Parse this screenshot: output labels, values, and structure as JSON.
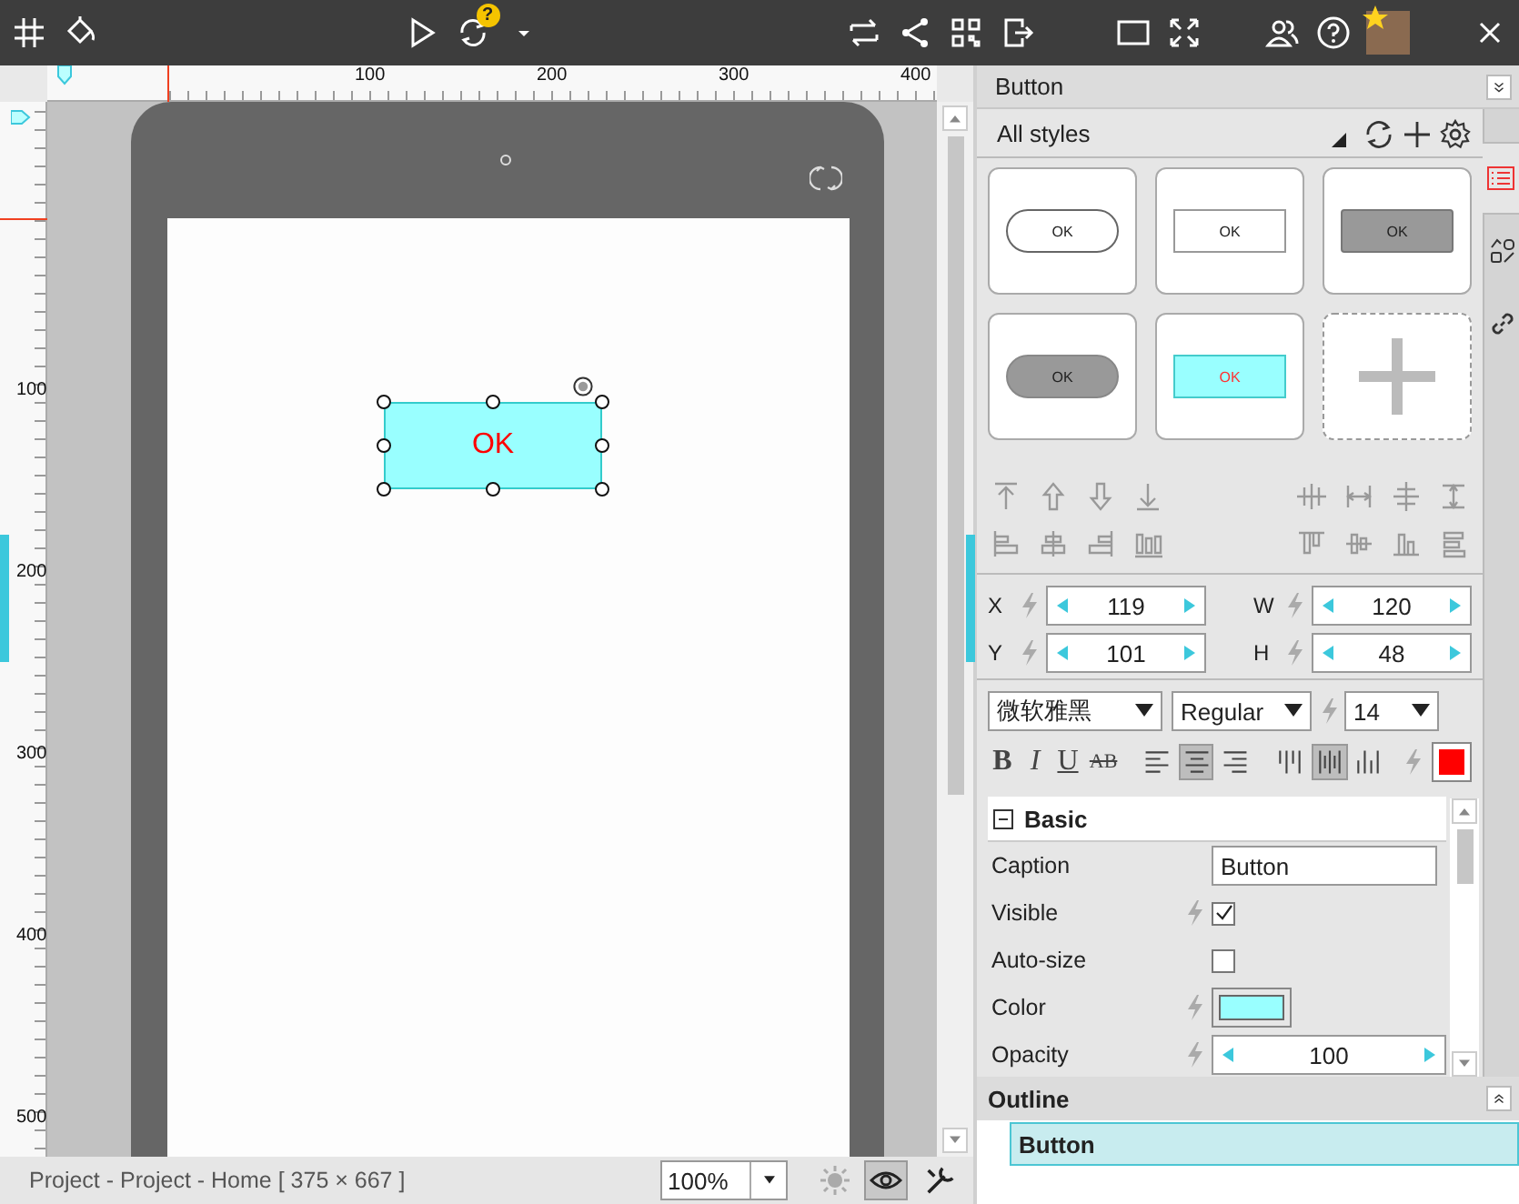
{
  "toolbar": {
    "help_badge": "?"
  },
  "rulers": {
    "horizontal": [
      "100",
      "200",
      "300",
      "400"
    ],
    "vertical": [
      "100",
      "200",
      "300",
      "400",
      "500"
    ]
  },
  "canvas": {
    "widget": {
      "caption": "OK",
      "selected": true
    }
  },
  "panel": {
    "title": "Button",
    "style_filter": "All styles",
    "styles": [
      {
        "kind": "pill",
        "label": "OK"
      },
      {
        "kind": "plain",
        "label": "OK"
      },
      {
        "kind": "dark",
        "label": "OK"
      },
      {
        "kind": "dark-pill",
        "label": "OK"
      },
      {
        "kind": "cyan",
        "label": "OK"
      },
      {
        "kind": "add"
      }
    ],
    "geometry": [
      {
        "label": "X",
        "value": "119",
        "linked": true
      },
      {
        "label": "W",
        "value": "120",
        "linked": true
      },
      {
        "label": "Y",
        "value": "101",
        "linked": true
      },
      {
        "label": "H",
        "value": "48",
        "linked": true
      }
    ],
    "font": {
      "family": "微软雅黑",
      "weight": "Regular",
      "size": "14"
    },
    "format_buttons": [
      {
        "kind": "bold",
        "label": "B"
      },
      {
        "kind": "italic",
        "label": "I"
      },
      {
        "kind": "underline",
        "label": "U"
      },
      {
        "kind": "strike",
        "label": "AB"
      }
    ],
    "h_align": [
      {
        "kind": "left",
        "selected": false
      },
      {
        "kind": "center",
        "selected": true
      },
      {
        "kind": "right",
        "selected": false
      }
    ],
    "v_align": [
      {
        "kind": "top",
        "selected": false
      },
      {
        "kind": "middle",
        "selected": true
      },
      {
        "kind": "bottom",
        "selected": false
      }
    ],
    "section": {
      "title": "Basic",
      "expanded": true
    },
    "properties": [
      {
        "kind": "text",
        "label": "Caption",
        "value": "Button",
        "linked": false
      },
      {
        "kind": "checkbox",
        "label": "Visible",
        "checked": true,
        "linked": true
      },
      {
        "kind": "checkbox",
        "label": "Auto-size",
        "checked": false,
        "linked": false
      },
      {
        "kind": "color",
        "label": "Color",
        "linked": true
      },
      {
        "kind": "spinner",
        "label": "Opacity",
        "value": "100",
        "linked": true
      }
    ]
  },
  "side_tabs": [
    {
      "kind": "styles",
      "selected": true
    },
    {
      "kind": "shapes",
      "selected": false
    },
    {
      "kind": "links",
      "selected": false
    }
  ],
  "outline": {
    "title": "Outline",
    "items": [
      {
        "label": "Button",
        "selected": true
      }
    ]
  },
  "status_bar": {
    "path": "Project - Project - Home [ 375 × 667 ]",
    "zoom": "100%",
    "tools": [
      {
        "kind": "sun",
        "selected": false
      },
      {
        "kind": "eye",
        "selected": true
      }
    ]
  }
}
